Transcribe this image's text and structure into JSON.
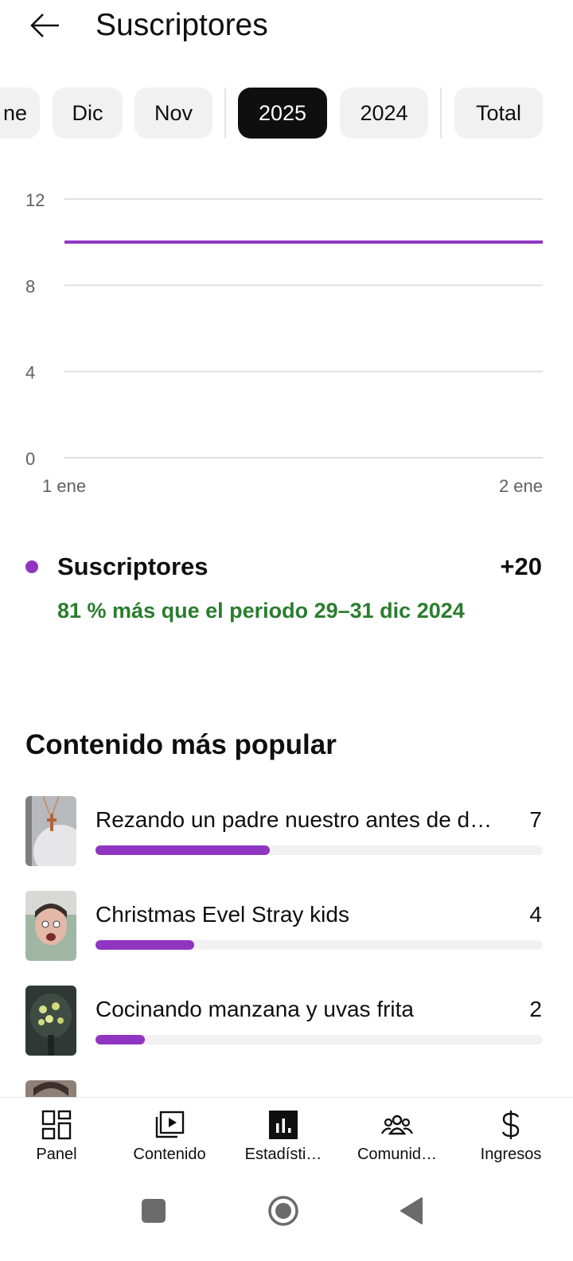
{
  "header": {
    "title": "Suscriptores"
  },
  "chips": [
    {
      "label": "ne",
      "selected": false
    },
    {
      "label": "Dic",
      "selected": false
    },
    {
      "label": "Nov",
      "selected": false
    },
    {
      "label": "2025",
      "selected": true
    },
    {
      "label": "2024",
      "selected": false
    },
    {
      "label": "Total",
      "selected": false
    }
  ],
  "chart_data": {
    "type": "line",
    "x_tick_labels": [
      "1 ene",
      "2 ene"
    ],
    "y_tick_labels": [
      "12",
      "8",
      "4",
      "0"
    ],
    "ylim": [
      0,
      12
    ],
    "grid": true,
    "series": [
      {
        "color": "#8f35c2",
        "x": [
          "1 ene",
          "2 ene"
        ],
        "values": [
          10,
          10
        ]
      }
    ]
  },
  "summary": {
    "metric_label": "Suscriptores",
    "metric_value": "+20",
    "comparison": "81 % más que el periodo 29–31 dic 2024",
    "accent_color": "#8f35c2",
    "comparison_color": "#2a7d2e"
  },
  "popular": {
    "title": "Contenido más popular",
    "items": [
      {
        "title": "Rezando un padre nuestro antes de dor…",
        "count": "7",
        "fraction": 0.39
      },
      {
        "title": "Christmas Evel Stray kids",
        "count": "4",
        "fraction": 0.22
      },
      {
        "title": "Cocinando manzana y uvas frita",
        "count": "2",
        "fraction": 0.11
      }
    ]
  },
  "bottom_nav": [
    {
      "label": "Panel",
      "icon": "dashboard-icon"
    },
    {
      "label": "Contenido",
      "icon": "content-icon"
    },
    {
      "label": "Estadísti…",
      "icon": "analytics-icon",
      "active": true
    },
    {
      "label": "Comunid…",
      "icon": "community-icon"
    },
    {
      "label": "Ingresos",
      "icon": "dollar-icon"
    }
  ],
  "system_nav": {
    "icons": [
      "recents-icon",
      "home-icon",
      "back-icon"
    ]
  }
}
